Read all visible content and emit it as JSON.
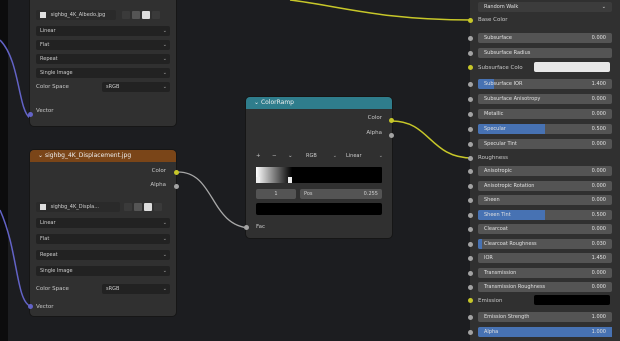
{
  "image_node_1": {
    "title": "sighbg_4K_Albedo.jpg",
    "interpolation": "Linear",
    "projection": "Flat",
    "extension": "Repeat",
    "source": "Single Image",
    "color_space_label": "Color Space",
    "color_space_value": "sRGB",
    "vector_label": "Vector"
  },
  "image_node_2": {
    "title": "sighbg_4K_Displacement.jpg",
    "output_color": "Color",
    "output_alpha": "Alpha",
    "image_name": "sighbg_4K_Displa...",
    "interpolation": "Linear",
    "projection": "Flat",
    "extension": "Repeat",
    "source": "Single Image",
    "color_space_label": "Color Space",
    "color_space_value": "sRGB",
    "vector_label": "Vector"
  },
  "color_ramp": {
    "title": "ColorRamp",
    "output_color": "Color",
    "output_alpha": "Alpha",
    "mode": "RGB",
    "interpolation": "Linear",
    "index": "1",
    "pos_label": "Pos",
    "pos_value": "0.255",
    "input_fac": "Fac"
  },
  "bsdf": {
    "random_walk": "Random Walk",
    "base_color": "Base Color",
    "roughness_label": "Roughness",
    "emission_label": "Emission",
    "subsurface_color_label": "Subsurface Colo",
    "rows_top": [
      {
        "label": "Subsurface",
        "value": "0.000",
        "fill": 0
      },
      {
        "label": "Subsurface Radius",
        "value": "",
        "fill": 0
      }
    ],
    "rows_mid": [
      {
        "label": "Subsurface IOR",
        "value": "1.400",
        "fill": 0.12
      },
      {
        "label": "Subsurface Anisotropy",
        "value": "0.000",
        "fill": 0
      },
      {
        "label": "Metallic",
        "value": "0.000",
        "fill": 0
      },
      {
        "label": "Specular",
        "value": "0.500",
        "fill": 0.5
      },
      {
        "label": "Specular Tint",
        "value": "0.000",
        "fill": 0
      }
    ],
    "rows_bottom": [
      {
        "label": "Anisotropic",
        "value": "0.000",
        "fill": 0
      },
      {
        "label": "Anisotropic Rotation",
        "value": "0.000",
        "fill": 0
      },
      {
        "label": "Sheen",
        "value": "0.000",
        "fill": 0
      },
      {
        "label": "Sheen Tint",
        "value": "0.500",
        "fill": 0.5
      },
      {
        "label": "Clearcoat",
        "value": "0.000",
        "fill": 0
      },
      {
        "label": "Clearcoat Roughness",
        "value": "0.030",
        "fill": 0.03
      },
      {
        "label": "IOR",
        "value": "1.450",
        "fill": 0
      },
      {
        "label": "Transmission",
        "value": "0.000",
        "fill": 0
      },
      {
        "label": "Transmission Roughness",
        "value": "0.000",
        "fill": 0
      }
    ],
    "rows_end": [
      {
        "label": "Emission Strength",
        "value": "1.000",
        "fill": 0
      },
      {
        "label": "Alpha",
        "value": "1.000",
        "fill": 1
      }
    ]
  },
  "colors": {
    "image_header": "#7a4518",
    "ramp_header": "#2f7d8c",
    "wire_yellow": "#c7c729",
    "wire_grey": "#9a9a9a",
    "wire_blue": "#6363c7",
    "accent_blue": "#4772b3"
  }
}
